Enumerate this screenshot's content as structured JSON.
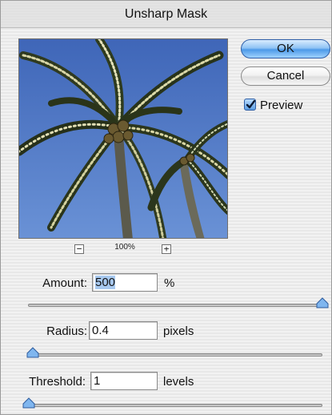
{
  "window": {
    "title": "Unsharp Mask"
  },
  "preview": {
    "zoom_label": "100%",
    "zoom_out_glyph": "−",
    "zoom_in_glyph": "+"
  },
  "buttons": {
    "ok": "OK",
    "cancel": "Cancel"
  },
  "preview_checkbox": {
    "label": "Preview",
    "checked": true
  },
  "controls": {
    "amount": {
      "label": "Amount:",
      "value": "500",
      "unit": "%",
      "slider_fraction": 1.0
    },
    "radius": {
      "label": "Radius:",
      "value": "0.4",
      "unit": "pixels",
      "slider_fraction": 0.0
    },
    "threshold": {
      "label": "Threshold:",
      "value": "1",
      "unit": "levels",
      "slider_fraction": 0.0
    }
  },
  "colors": {
    "aqua_blue": "#4d9ae8",
    "selection": "#a8c9ef",
    "sky": "#4670c0"
  }
}
